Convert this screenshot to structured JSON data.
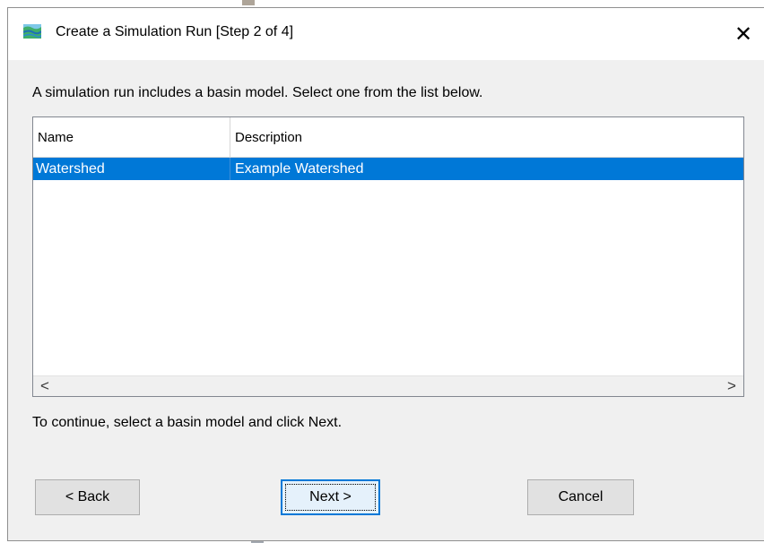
{
  "window": {
    "title": "Create a Simulation Run [Step 2 of 4]",
    "icon": "hec-hms-app-icon",
    "close_label": "✕"
  },
  "intro_text": "A simulation run includes a basin model. Select one from the list below.",
  "table": {
    "columns": [
      "Name",
      "Description"
    ],
    "rows": [
      {
        "name": "Watershed",
        "description": "Example Watershed",
        "selected": true
      }
    ],
    "scroll_left_label": "<",
    "scroll_right_label": ">"
  },
  "hint_text": "To continue, select a basin model and click Next.",
  "buttons": {
    "back": "< Back",
    "next": "Next >",
    "cancel": "Cancel"
  },
  "colors": {
    "selection": "#0078d7",
    "dialog_bg": "#f0f0f0",
    "focus_border": "#0078d7"
  }
}
